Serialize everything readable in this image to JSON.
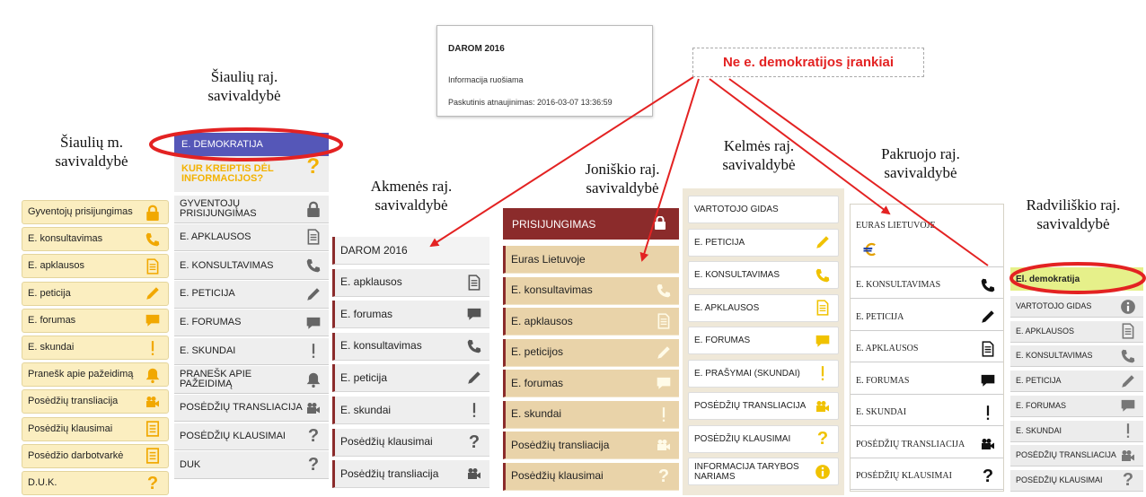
{
  "captions": {
    "siauliu_m": "Šiaulių m. savivaldybė",
    "siauliu_raj": "Šiaulių raj. savivaldybė",
    "akmenes": "Akmenės raj. savivaldybė",
    "joniskio": "Joniškio raj. savivaldybė",
    "kelmes": "Kelmės raj. savivaldybė",
    "pakruojo": "Pakruojo raj. savivaldybė",
    "radviliskio": "Radviliškio raj. savivaldybė"
  },
  "annotation": {
    "label": "Ne e. demokratijos įrankiai",
    "color": "#e32222"
  },
  "tooltip": {
    "title": "DAROM 2016",
    "status": "Informacija ruošiama",
    "updated": "Paskutinis atnaujinimas: 2016-03-07 13:36:59"
  },
  "panel_siauliu_m": {
    "items": [
      {
        "label": "Gyventojų prisijungimas",
        "icon": "lock-icon"
      },
      {
        "label": "E. konsultavimas",
        "icon": "phone-icon"
      },
      {
        "label": "E. apklausos",
        "icon": "document-icon"
      },
      {
        "label": "E. peticija",
        "icon": "pen-icon"
      },
      {
        "label": "E. forumas",
        "icon": "chat-icon"
      },
      {
        "label": "E. skundai",
        "icon": "exclamation-icon"
      },
      {
        "label": "Pranešk apie pažeidimą",
        "icon": "bell-icon"
      },
      {
        "label": "Posėdžių transliacija",
        "icon": "camera-icon"
      },
      {
        "label": "Posėdžių klausimai",
        "icon": "list-icon"
      },
      {
        "label": "Posėdžio darbotvarkė",
        "icon": "list-icon"
      },
      {
        "label": "D.U.K.",
        "icon": "question-icon"
      }
    ]
  },
  "panel_siauliu_raj": {
    "header": "E. DEMOKRATIJA",
    "header_color": "#5557b8",
    "subheader": "KUR KREIPTIS DĖL INFORMACIJOS?",
    "items": [
      {
        "label": "GYVENTOJŲ PRISIJUNGIMAS",
        "icon": "lock-icon"
      },
      {
        "label": "E. APKLAUSOS",
        "icon": "document-icon"
      },
      {
        "label": "E. KONSULTAVIMAS",
        "icon": "phone-icon"
      },
      {
        "label": "E. PETICIJA",
        "icon": "pen-icon"
      },
      {
        "label": "E. FORUMAS",
        "icon": "chat-icon"
      },
      {
        "label": "E. SKUNDAI",
        "icon": "exclamation-icon"
      },
      {
        "label": "PRANEŠK APIE PAŽEIDIMĄ",
        "icon": "bell-icon"
      },
      {
        "label": "POSĖDŽIŲ TRANSLIACIJA",
        "icon": "camera-icon"
      },
      {
        "label": "POSĖDŽIŲ KLAUSIMAI",
        "icon": "question-icon"
      },
      {
        "label": "DUK",
        "icon": "question-icon"
      }
    ]
  },
  "panel_akmenes": {
    "items": [
      {
        "label": "DAROM 2016",
        "icon": ""
      },
      {
        "label": "E. apklausos",
        "icon": "document-icon"
      },
      {
        "label": "E. forumas",
        "icon": "chat-icon"
      },
      {
        "label": "E. konsultavimas",
        "icon": "phone-icon"
      },
      {
        "label": "E. peticija",
        "icon": "pen-icon"
      },
      {
        "label": "E. skundai",
        "icon": "exclamation-icon"
      },
      {
        "label": "Posėdžių klausimai",
        "icon": "question-icon"
      },
      {
        "label": "Posėdžių transliacija",
        "icon": "camera-icon"
      }
    ]
  },
  "panel_joniskio": {
    "header": "PRISIJUNGIMAS",
    "header_color": "#8b2b2b",
    "items": [
      {
        "label": "Euras Lietuvoje",
        "icon": ""
      },
      {
        "label": "E. konsultavimas",
        "icon": "phone-icon"
      },
      {
        "label": "E. apklausos",
        "icon": "document-icon"
      },
      {
        "label": "E. peticijos",
        "icon": "pen-icon"
      },
      {
        "label": "E. forumas",
        "icon": "chat-icon"
      },
      {
        "label": "E. skundai",
        "icon": "exclamation-icon"
      },
      {
        "label": "Posėdžių transliacija",
        "icon": "camera-icon"
      },
      {
        "label": "Posėdžių klausimai",
        "icon": "question-icon"
      }
    ]
  },
  "panel_kelmes": {
    "items": [
      {
        "label": "VARTOTOJO GIDAS",
        "icon": ""
      },
      {
        "label": "E. PETICIJA",
        "icon": "pen-icon"
      },
      {
        "label": "E. KONSULTAVIMAS",
        "icon": "phone-icon"
      },
      {
        "label": "E. APKLAUSOS",
        "icon": "document-icon"
      },
      {
        "label": "E. FORUMAS",
        "icon": "chat-icon"
      },
      {
        "label": "E. PRAŠYMAI (SKUNDAI)",
        "icon": "exclamation-icon"
      },
      {
        "label": "POSĖDŽIŲ TRANSLIACIJA",
        "icon": "camera-icon"
      },
      {
        "label": "POSĖDŽIŲ KLAUSIMAI",
        "icon": "question-icon"
      },
      {
        "label": "INFORMACIJA TARYBOS NARIAMS",
        "icon": "info-icon"
      }
    ]
  },
  "panel_pakruojo": {
    "items": [
      {
        "label": "EURAS LIETUVOJE",
        "icon": "euro-icon"
      },
      {
        "label": "E. KONSULTAVIMAS",
        "icon": "phone-icon"
      },
      {
        "label": "E. PETICIJA",
        "icon": "pen-icon"
      },
      {
        "label": "E. APKLAUSOS",
        "icon": "document-icon"
      },
      {
        "label": "E. FORUMAS",
        "icon": "chat-icon"
      },
      {
        "label": "E. SKUNDAI",
        "icon": "exclamation-icon"
      },
      {
        "label": "POSĖDŽIŲ TRANSLIACIJA",
        "icon": "camera-icon"
      },
      {
        "label": "POSĖDŽIŲ KLAUSIMAI",
        "icon": "question-icon"
      }
    ]
  },
  "panel_radviliskio": {
    "header": "El. demokratija",
    "header_color": "#e6f08a",
    "items": [
      {
        "label": "VARTOTOJO GIDAS",
        "icon": "info-icon"
      },
      {
        "label": "E. APKLAUSOS",
        "icon": "document-icon"
      },
      {
        "label": "E. KONSULTAVIMAS",
        "icon": "phone-icon"
      },
      {
        "label": "E. PETICIJA",
        "icon": "pen-icon"
      },
      {
        "label": "E. FORUMAS",
        "icon": "chat-icon"
      },
      {
        "label": "E. SKUNDAI",
        "icon": "exclamation-icon"
      },
      {
        "label": "POSĖDŽIŲ TRANSLIACIJA",
        "icon": "camera-icon"
      },
      {
        "label": "POSĖDŽIŲ KLAUSIMAI",
        "icon": "question-icon"
      }
    ]
  }
}
